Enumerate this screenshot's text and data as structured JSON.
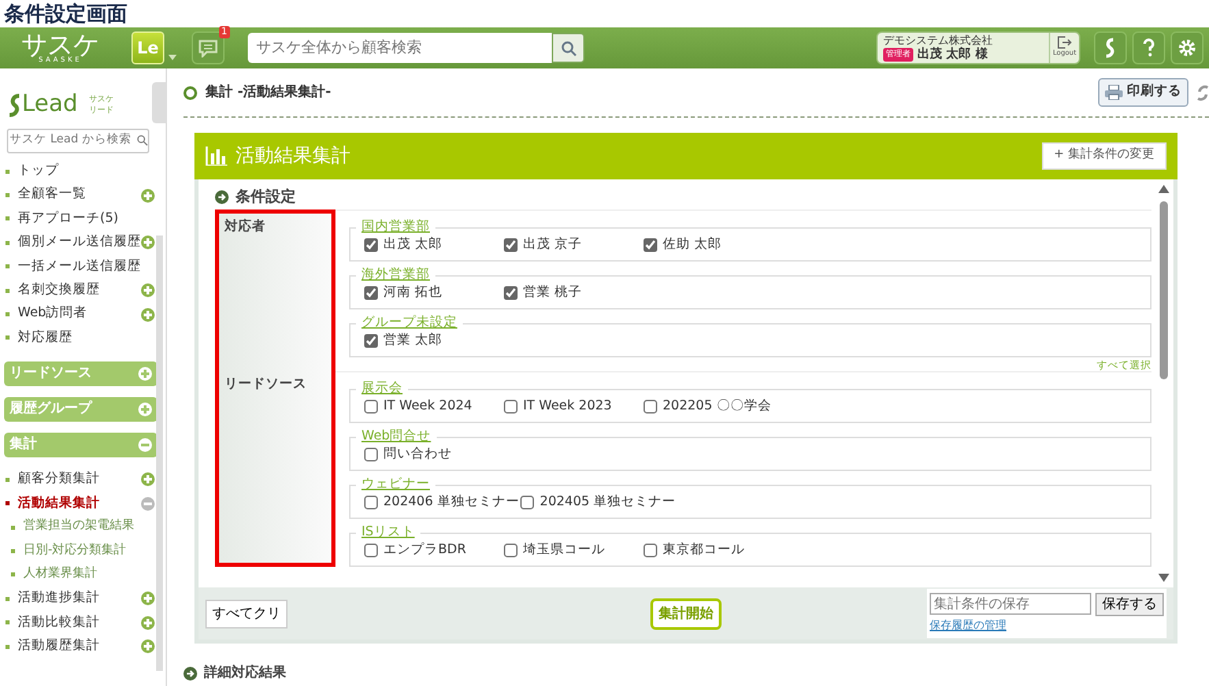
{
  "page_title": "条件設定画面",
  "header": {
    "logo": "サスケ",
    "logo_sub": "SAASKE",
    "app_badge": "Le",
    "notification_count": "1",
    "search": {
      "placeholder": "サスケ全体から顧客検索"
    },
    "company": "デモシステム株式会社",
    "role_badge": "管理者",
    "user": "出茂 太郎 様",
    "logout": "Logout"
  },
  "sidebar": {
    "logo": "Lead",
    "logo_sub": [
      "サスケ",
      "リード"
    ],
    "search": {
      "placeholder": "サスケ Lead から検索"
    },
    "items": [
      {
        "label": "トップ"
      },
      {
        "label": "全顧客一覧",
        "expanded": false
      },
      {
        "label": "再アプローチ(5)"
      },
      {
        "label": "個別メール送信履歴",
        "expanded": false
      },
      {
        "label": "一括メール送信履歴"
      },
      {
        "label": "名刺交換履歴",
        "expanded": false
      },
      {
        "label": "Web訪問者",
        "expanded": false
      },
      {
        "label": "対応履歴"
      }
    ],
    "sections": [
      {
        "label": "リードソース",
        "expanded": false
      },
      {
        "label": "履歴グループ",
        "expanded": false
      },
      {
        "label": "集計",
        "expanded": true,
        "items": [
          {
            "label": "顧客分類集計",
            "expanded": false,
            "selected": false
          },
          {
            "label": "活動結果集計",
            "expanded": true,
            "selected": true,
            "children": [
              {
                "label": "営業担当の架電結果"
              },
              {
                "label": "日別-対応分類集計"
              },
              {
                "label": "人材業界集計"
              }
            ]
          },
          {
            "label": "活動進捗集計",
            "expanded": false,
            "selected": false
          },
          {
            "label": "活動比較集計",
            "expanded": false,
            "selected": false
          },
          {
            "label": "活動履歴集計",
            "expanded": false,
            "selected": false
          }
        ]
      }
    ]
  },
  "breadcrumb": "集計 -活動結果集計-",
  "print_button": "印刷する",
  "panel": {
    "title": "活動結果集計",
    "change_button": "+ 集計条件の変更",
    "section_heading": "条件設定",
    "label_column_highlighted": true,
    "criteria": [
      {
        "label": "対応者",
        "select_all": "すべて選択",
        "groups": [
          {
            "name": "国内営業部",
            "options": [
              {
                "label": "出茂 太郎",
                "checked": true
              },
              {
                "label": "出茂 京子",
                "checked": true
              },
              {
                "label": "佐助 太郎",
                "checked": true
              }
            ]
          },
          {
            "name": "海外営業部",
            "options": [
              {
                "label": "河南 拓也",
                "checked": true
              },
              {
                "label": "営業 桃子",
                "checked": true
              }
            ]
          },
          {
            "name": "グループ未設定",
            "options": [
              {
                "label": "営業 太郎",
                "checked": true
              }
            ]
          }
        ]
      },
      {
        "label": "リードソース",
        "groups": [
          {
            "name": "展示会",
            "options": [
              {
                "label": "IT Week 2024",
                "checked": false
              },
              {
                "label": "IT Week 2023",
                "checked": false
              },
              {
                "label": "202205 〇〇学会",
                "checked": false
              }
            ]
          },
          {
            "name": "Web問合せ",
            "options": [
              {
                "label": "問い合わせ",
                "checked": false
              }
            ]
          },
          {
            "name": "ウェビナー",
            "options": [
              {
                "label": "202406 単独セミナー",
                "checked": false
              },
              {
                "label": "202405 単独セミナー",
                "checked": false
              }
            ]
          },
          {
            "name": "ISリスト",
            "options": [
              {
                "label": "エンプラBDR",
                "checked": false
              },
              {
                "label": "埼玉県コール",
                "checked": false
              },
              {
                "label": "東京都コール",
                "checked": false
              }
            ]
          }
        ]
      }
    ],
    "clear_button": "すべてクリ",
    "start_button": "集計開始",
    "save_field": {
      "placeholder": "集計条件の保存"
    },
    "save_button": "保存する",
    "history_link": "保存履歴の管理"
  },
  "next_section": "詳細対応結果"
}
